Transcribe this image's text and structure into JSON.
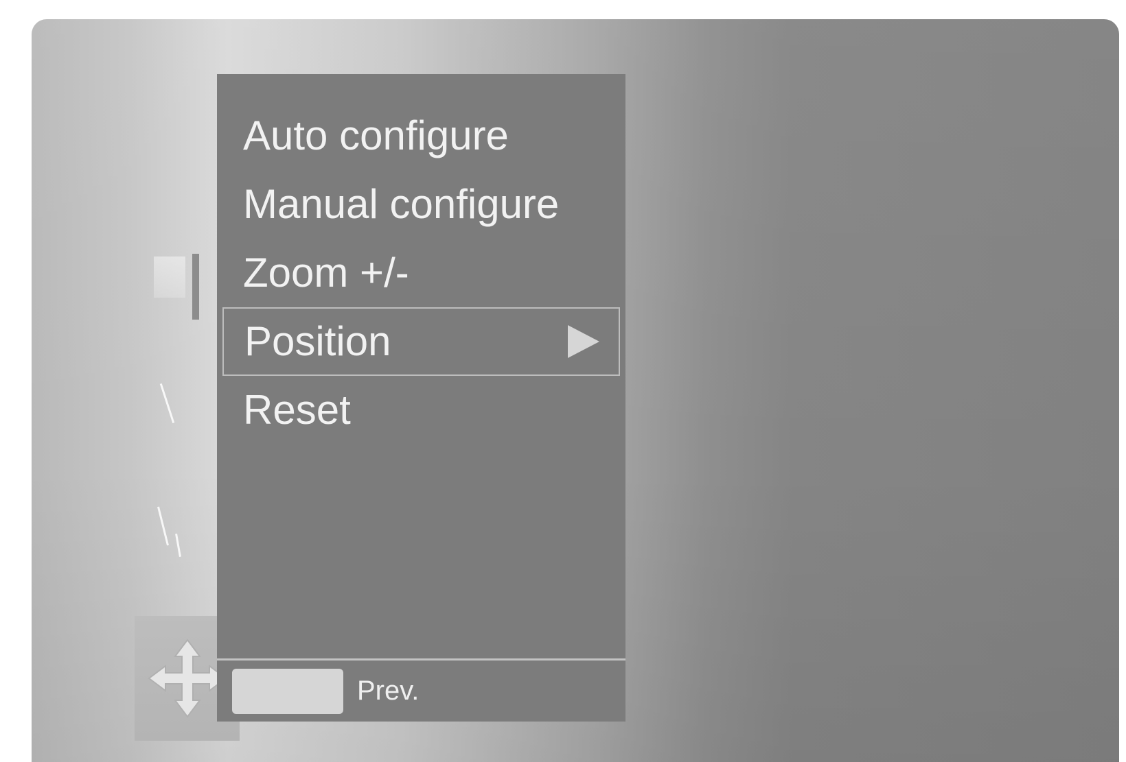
{
  "menu": {
    "items": [
      {
        "label": "Auto configure",
        "selected": false
      },
      {
        "label": "Manual configure",
        "selected": false
      },
      {
        "label": "Zoom +/-",
        "selected": false
      },
      {
        "label": "Position",
        "selected": true,
        "has_submenu": true
      },
      {
        "label": "Reset",
        "selected": false
      }
    ]
  },
  "footer": {
    "button_color": "#d6d6d6",
    "prev_label": "Prev."
  },
  "icons": {
    "category_icon": "move-arrows-icon",
    "submenu_indicator": "triangle-right-icon"
  }
}
